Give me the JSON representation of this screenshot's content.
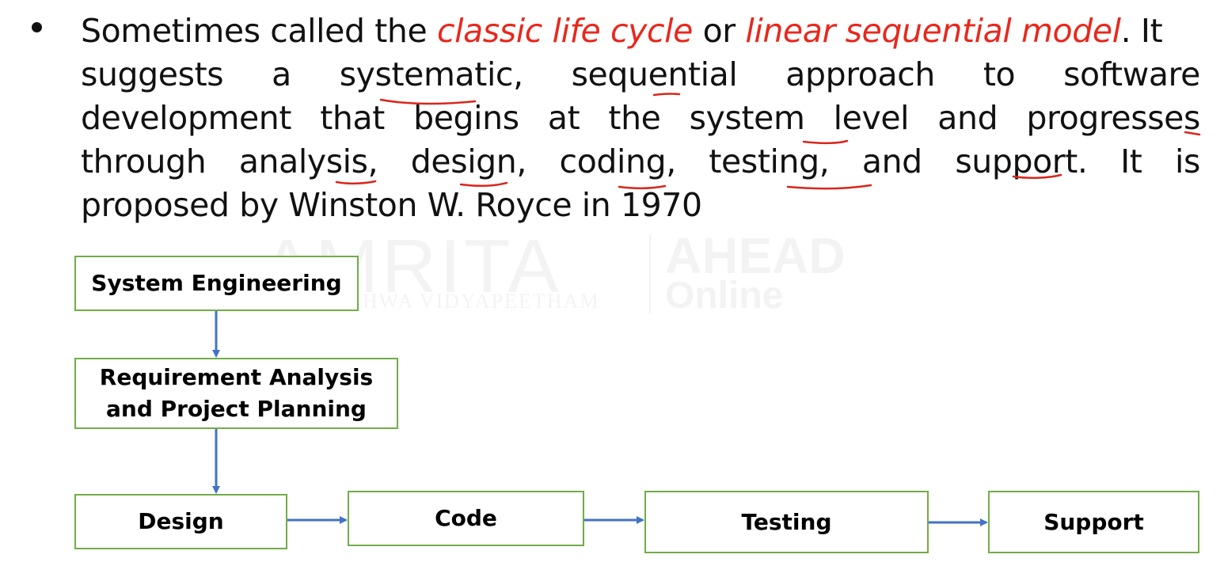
{
  "text": {
    "lines": [
      [
        {
          "t": "Sometimes called the "
        },
        {
          "t": "classic life cycle",
          "hl": true
        },
        {
          "t": " or "
        },
        {
          "t": "linear sequential model",
          "hl": true
        },
        {
          "t": ". It"
        }
      ],
      [
        "suggests",
        "a",
        "systematic,",
        "sequential",
        "approach",
        "to",
        "software"
      ],
      [
        "development",
        "that",
        "begins",
        "at",
        "the",
        "system",
        "level",
        "and",
        "progresses"
      ],
      [
        "through",
        "analysis,",
        "design,",
        "coding,",
        "testing,",
        "and",
        "support.",
        "It",
        "is"
      ],
      "proposed by Winston W. Royce in 1970"
    ]
  },
  "watermark": {
    "brand": "AMRITA",
    "subtitle": "VISHWA VIDYAPEETHAM",
    "right_top": "AHEAD",
    "right_bottom": "Online"
  },
  "diagram": {
    "nodes": [
      {
        "id": "system-engineering",
        "label": "System Engineering"
      },
      {
        "id": "requirement-analysis",
        "label": "Requirement Analysis\nand Project Planning"
      },
      {
        "id": "design",
        "label": "Design"
      },
      {
        "id": "code",
        "label": "Code"
      },
      {
        "id": "testing",
        "label": "Testing"
      },
      {
        "id": "support",
        "label": "Support"
      }
    ],
    "edges": [
      [
        "system-engineering",
        "requirement-analysis"
      ],
      [
        "requirement-analysis",
        "design"
      ],
      [
        "design",
        "code"
      ],
      [
        "code",
        "testing"
      ],
      [
        "testing",
        "support"
      ]
    ]
  },
  "colors": {
    "highlight": "#e8281d",
    "node_border": "#70ad47",
    "arrow": "#4472c4",
    "annotation": "#d9261c"
  }
}
